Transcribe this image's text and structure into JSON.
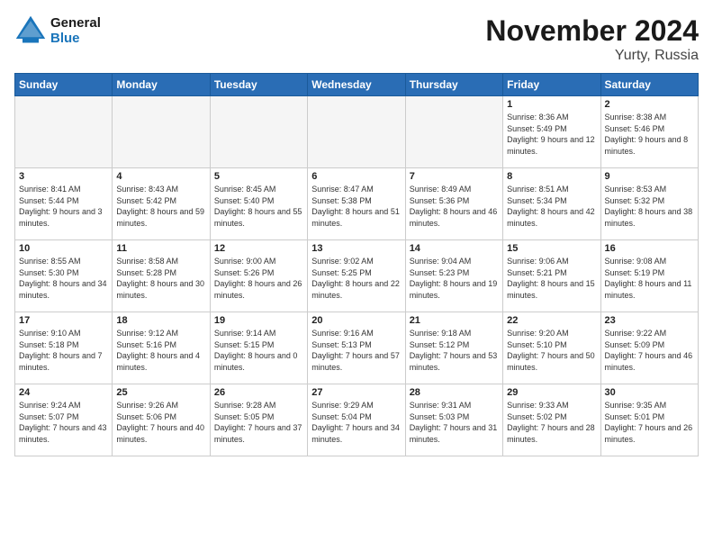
{
  "header": {
    "logo_line1": "General",
    "logo_line2": "Blue",
    "month": "November 2024",
    "location": "Yurty, Russia"
  },
  "weekdays": [
    "Sunday",
    "Monday",
    "Tuesday",
    "Wednesday",
    "Thursday",
    "Friday",
    "Saturday"
  ],
  "weeks": [
    [
      {
        "day": "",
        "info": ""
      },
      {
        "day": "",
        "info": ""
      },
      {
        "day": "",
        "info": ""
      },
      {
        "day": "",
        "info": ""
      },
      {
        "day": "",
        "info": ""
      },
      {
        "day": "1",
        "info": "Sunrise: 8:36 AM\nSunset: 5:49 PM\nDaylight: 9 hours and 12 minutes."
      },
      {
        "day": "2",
        "info": "Sunrise: 8:38 AM\nSunset: 5:46 PM\nDaylight: 9 hours and 8 minutes."
      }
    ],
    [
      {
        "day": "3",
        "info": "Sunrise: 8:41 AM\nSunset: 5:44 PM\nDaylight: 9 hours and 3 minutes."
      },
      {
        "day": "4",
        "info": "Sunrise: 8:43 AM\nSunset: 5:42 PM\nDaylight: 8 hours and 59 minutes."
      },
      {
        "day": "5",
        "info": "Sunrise: 8:45 AM\nSunset: 5:40 PM\nDaylight: 8 hours and 55 minutes."
      },
      {
        "day": "6",
        "info": "Sunrise: 8:47 AM\nSunset: 5:38 PM\nDaylight: 8 hours and 51 minutes."
      },
      {
        "day": "7",
        "info": "Sunrise: 8:49 AM\nSunset: 5:36 PM\nDaylight: 8 hours and 46 minutes."
      },
      {
        "day": "8",
        "info": "Sunrise: 8:51 AM\nSunset: 5:34 PM\nDaylight: 8 hours and 42 minutes."
      },
      {
        "day": "9",
        "info": "Sunrise: 8:53 AM\nSunset: 5:32 PM\nDaylight: 8 hours and 38 minutes."
      }
    ],
    [
      {
        "day": "10",
        "info": "Sunrise: 8:55 AM\nSunset: 5:30 PM\nDaylight: 8 hours and 34 minutes."
      },
      {
        "day": "11",
        "info": "Sunrise: 8:58 AM\nSunset: 5:28 PM\nDaylight: 8 hours and 30 minutes."
      },
      {
        "day": "12",
        "info": "Sunrise: 9:00 AM\nSunset: 5:26 PM\nDaylight: 8 hours and 26 minutes."
      },
      {
        "day": "13",
        "info": "Sunrise: 9:02 AM\nSunset: 5:25 PM\nDaylight: 8 hours and 22 minutes."
      },
      {
        "day": "14",
        "info": "Sunrise: 9:04 AM\nSunset: 5:23 PM\nDaylight: 8 hours and 19 minutes."
      },
      {
        "day": "15",
        "info": "Sunrise: 9:06 AM\nSunset: 5:21 PM\nDaylight: 8 hours and 15 minutes."
      },
      {
        "day": "16",
        "info": "Sunrise: 9:08 AM\nSunset: 5:19 PM\nDaylight: 8 hours and 11 minutes."
      }
    ],
    [
      {
        "day": "17",
        "info": "Sunrise: 9:10 AM\nSunset: 5:18 PM\nDaylight: 8 hours and 7 minutes."
      },
      {
        "day": "18",
        "info": "Sunrise: 9:12 AM\nSunset: 5:16 PM\nDaylight: 8 hours and 4 minutes."
      },
      {
        "day": "19",
        "info": "Sunrise: 9:14 AM\nSunset: 5:15 PM\nDaylight: 8 hours and 0 minutes."
      },
      {
        "day": "20",
        "info": "Sunrise: 9:16 AM\nSunset: 5:13 PM\nDaylight: 7 hours and 57 minutes."
      },
      {
        "day": "21",
        "info": "Sunrise: 9:18 AM\nSunset: 5:12 PM\nDaylight: 7 hours and 53 minutes."
      },
      {
        "day": "22",
        "info": "Sunrise: 9:20 AM\nSunset: 5:10 PM\nDaylight: 7 hours and 50 minutes."
      },
      {
        "day": "23",
        "info": "Sunrise: 9:22 AM\nSunset: 5:09 PM\nDaylight: 7 hours and 46 minutes."
      }
    ],
    [
      {
        "day": "24",
        "info": "Sunrise: 9:24 AM\nSunset: 5:07 PM\nDaylight: 7 hours and 43 minutes."
      },
      {
        "day": "25",
        "info": "Sunrise: 9:26 AM\nSunset: 5:06 PM\nDaylight: 7 hours and 40 minutes."
      },
      {
        "day": "26",
        "info": "Sunrise: 9:28 AM\nSunset: 5:05 PM\nDaylight: 7 hours and 37 minutes."
      },
      {
        "day": "27",
        "info": "Sunrise: 9:29 AM\nSunset: 5:04 PM\nDaylight: 7 hours and 34 minutes."
      },
      {
        "day": "28",
        "info": "Sunrise: 9:31 AM\nSunset: 5:03 PM\nDaylight: 7 hours and 31 minutes."
      },
      {
        "day": "29",
        "info": "Sunrise: 9:33 AM\nSunset: 5:02 PM\nDaylight: 7 hours and 28 minutes."
      },
      {
        "day": "30",
        "info": "Sunrise: 9:35 AM\nSunset: 5:01 PM\nDaylight: 7 hours and 26 minutes."
      }
    ]
  ]
}
